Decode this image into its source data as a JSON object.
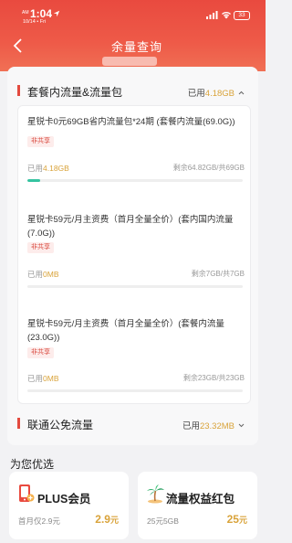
{
  "status": {
    "time": "1:04",
    "ampm": "AM",
    "date": "10/14 • Fri",
    "battery": "33"
  },
  "header": {
    "title": "余量查询"
  },
  "package_section": {
    "title": "套餐内流量&流量包",
    "used_label": "已用",
    "used_amount": "4.18GB",
    "items": [
      {
        "name": "星锐卡0元69GB省内流量包*24期 (套餐内流量(69.0G))",
        "tag": "非共享",
        "used_label": "已用",
        "used_amount": "4.18GB",
        "remain": "剩余64.82GB/共69GB",
        "progress": 0.06
      },
      {
        "name": "星锐卡59元/月主资费（首月全量全价）(套内国内流量(7.0G))",
        "tag": "非共享",
        "used_label": "已用",
        "used_amount": "0MB",
        "remain": "剩余7GB/共7GB",
        "progress": 0
      },
      {
        "name": "星锐卡59元/月主资费（首月全量全价）(套餐内流量(23.0G))",
        "tag": "非共享",
        "used_label": "已用",
        "used_amount": "0MB",
        "remain": "剩余23GB/共23GB",
        "progress": 0
      }
    ]
  },
  "free_section": {
    "title": "联通公免流量",
    "used_label": "已用",
    "used_amount": "23.32MB"
  },
  "recommend": {
    "title": "为您优选",
    "cards": [
      {
        "name": "PLUS会员",
        "sub": "首月仅2.9元",
        "price": "2.9",
        "unit": "元",
        "icon": "phone-plus-icon"
      },
      {
        "name": "流量权益红包",
        "sub": "25元5GB",
        "price": "25",
        "unit": "元",
        "icon": "palm-tree-icon"
      }
    ]
  },
  "colors": {
    "brand": "#e94a3f",
    "accent": "#d9a33a",
    "progress": "#35c3a0"
  }
}
